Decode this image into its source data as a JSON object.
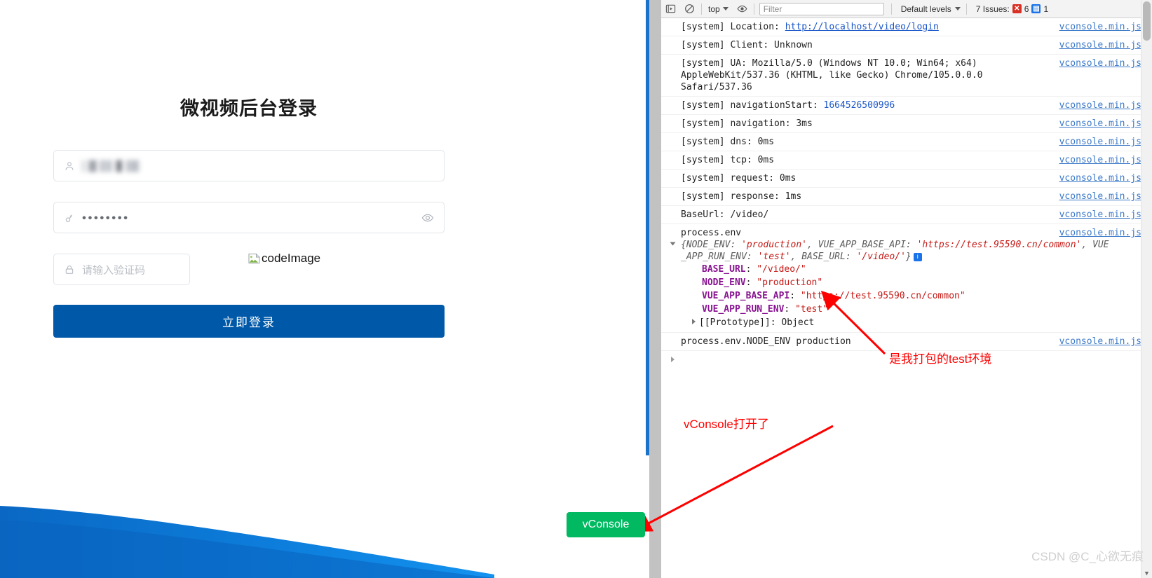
{
  "login": {
    "title": "微视频后台登录",
    "username": {
      "value": "████████",
      "icon": "user-icon"
    },
    "password": {
      "value": "••••••••",
      "icon": "key-icon",
      "toggle_icon": "eye-icon"
    },
    "captcha": {
      "placeholder": "请输入验证码",
      "icon": "lock-icon"
    },
    "captcha_image_alt": "codeImage",
    "submit_label": "立即登录"
  },
  "devtools": {
    "toolbar": {
      "execute_icon": "execute-snippet-icon",
      "clear_icon": "clear-console-icon",
      "context_label": "top",
      "eye_icon": "live-expression-icon",
      "filter_placeholder": "Filter",
      "levels_label": "Default levels",
      "issues_label": "7 Issues:",
      "issues_error_count": "6",
      "issues_info_count": "1"
    },
    "source_link": "vconsole.min.js",
    "rows": [
      {
        "text": "[system] Location: ",
        "link": "http://localhost/video/login"
      },
      {
        "text": "[system] Client: Unknown"
      },
      {
        "text": "[system] UA: Mozilla/5.0 (Windows NT 10.0; Win64; x64) AppleWebKit/537.36 (KHTML, like Gecko) Chrome/105.0.0.0 Safari/537.36"
      },
      {
        "text": "[system] navigationStart: ",
        "number": "1664526500996"
      },
      {
        "text": "[system] navigation: 3ms"
      },
      {
        "text": "[system] dns: 0ms"
      },
      {
        "text": "[system] tcp: 0ms"
      },
      {
        "text": "[system] request: 0ms"
      },
      {
        "text": "[system] response: 1ms"
      },
      {
        "text": "BaseUrl: /video/"
      }
    ],
    "env_object": {
      "label": "process.env",
      "preview_line1_prefix": "{NODE_ENV: ",
      "preview_line1_v1": "'production'",
      "preview_line1_mid": ", VUE_APP_BASE_API: ",
      "preview_line1_v2": "'https://test.95590.cn/common'",
      "preview_line1_suffix": ", VUE",
      "preview_line2_prefix": "_APP_RUN_ENV: ",
      "preview_line2_v1": "'test'",
      "preview_line2_mid": ", BASE_URL: ",
      "preview_line2_v2": "'/video/'",
      "preview_line2_suffix": "}",
      "info_badge": "i",
      "props": [
        {
          "key": "BASE_URL",
          "value": "\"/video/\""
        },
        {
          "key": "NODE_ENV",
          "value": "\"production\""
        },
        {
          "key": "VUE_APP_BASE_API",
          "value": "\"https://test.95590.cn/common\""
        },
        {
          "key": "VUE_APP_RUN_ENV",
          "value": "\"test\""
        }
      ],
      "prototype_label": "[[Prototype]]: Object"
    },
    "last_row": "process.env.NODE_ENV production"
  },
  "annotations": {
    "test_env": "是我打包的test环境",
    "vconsole_open": "vConsole打开了"
  },
  "vconsole_button_label": "vConsole",
  "watermark": "CSDN @C_心欲无痕",
  "colors": {
    "primary_blue": "#0059a8",
    "devtools_accent": "#1a73c8",
    "annotation_red": "#ff0000",
    "vconsole_green": "#00b960",
    "link_blue": "#1a56c9",
    "object_key_purple": "#881391",
    "string_red": "#c41a16"
  }
}
